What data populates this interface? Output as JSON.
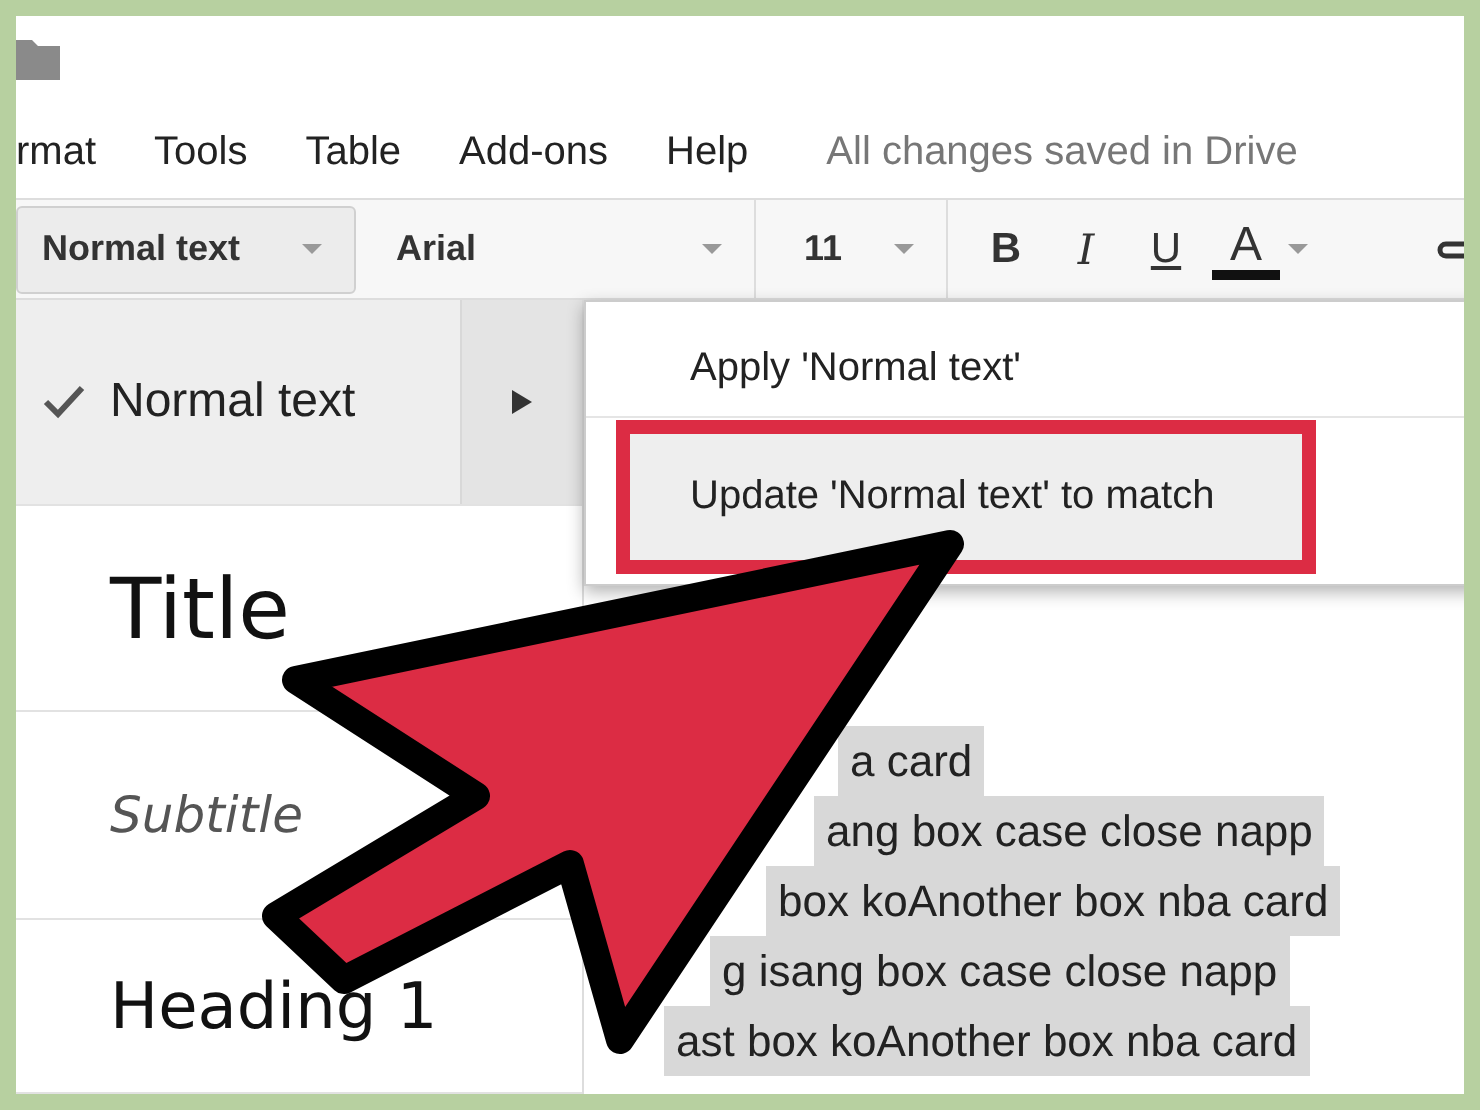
{
  "menu_bar": {
    "items": [
      "rmat",
      "Tools",
      "Table",
      "Add-ons",
      "Help"
    ],
    "status": "All changes saved in Drive"
  },
  "toolbar": {
    "style_select": "Normal text",
    "font_select": "Arial",
    "size_select": "11",
    "buttons": [
      {
        "label": "B",
        "kind": "bold"
      },
      {
        "label": "I",
        "kind": "italic"
      },
      {
        "label": "U",
        "kind": "underline"
      },
      {
        "label": "A",
        "kind": "color"
      }
    ]
  },
  "styles_menu": {
    "items": [
      {
        "label": "Normal text",
        "kind": "normal",
        "checked": true,
        "expanded": true
      },
      {
        "label": "Title",
        "kind": "title",
        "checked": false,
        "expanded": false
      },
      {
        "label": "Subtitle",
        "kind": "subtitle",
        "checked": false,
        "expanded": false
      },
      {
        "label": "Heading 1",
        "kind": "heading1",
        "checked": false,
        "expanded": false
      }
    ]
  },
  "submenu": {
    "items": [
      {
        "label": "Apply 'Normal text'",
        "selected": false
      },
      {
        "label": "Update 'Normal text' to match",
        "selected": true
      }
    ]
  },
  "document": {
    "lines": [
      "a card",
      "ang box case close napp",
      "box koAnother box nba card",
      "g isang box case close napp",
      "ast box koAnother box nba card"
    ]
  }
}
